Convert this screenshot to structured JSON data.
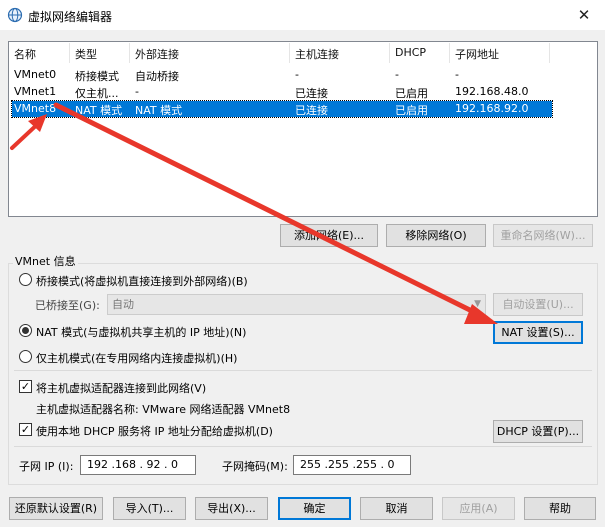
{
  "window": {
    "title": "虚拟网络编辑器",
    "close_glyph": "✕"
  },
  "table": {
    "headers": [
      "名称",
      "类型",
      "外部连接",
      "主机连接",
      "DHCP",
      "子网地址"
    ],
    "rows": [
      {
        "name": "VMnet0",
        "type": "桥接模式",
        "external": "自动桥接",
        "host": "-",
        "dhcp": "-",
        "subnet": "-",
        "selected": false
      },
      {
        "name": "VMnet1",
        "type": "仅主机...",
        "external": "-",
        "host": "已连接",
        "dhcp": "已启用",
        "subnet": "192.168.48.0",
        "selected": false
      },
      {
        "name": "VMnet8",
        "type": "NAT 模式",
        "external": "NAT 模式",
        "host": "已连接",
        "dhcp": "已启用",
        "subnet": "192.168.92.0",
        "selected": true
      }
    ]
  },
  "list_buttons": {
    "add": "添加网络(E)...",
    "remove": "移除网络(O)",
    "rename": "重命名网络(W)..."
  },
  "vmnet_info": {
    "group_title": "VMnet 信息",
    "bridge_mode": "桥接模式(将虚拟机直接连接到外部网络)(B)",
    "bridged_to_label": "已桥接至(G):",
    "bridged_to_value": "自动",
    "auto_settings": "自动设置(U)...",
    "nat_mode": "NAT 模式(与虚拟机共享主机的 IP 地址)(N)",
    "nat_settings": "NAT 设置(S)...",
    "host_only": "仅主机模式(在专用网络内连接虚拟机)(H)",
    "connect_adapter": "将主机虚拟适配器连接到此网络(V)",
    "adapter_name": "主机虚拟适配器名称: VMware 网络适配器 VMnet8",
    "use_dhcp": "使用本地 DHCP 服务将 IP 地址分配给虚拟机(D)",
    "dhcp_settings": "DHCP 设置(P)...",
    "subnet_ip_label": "子网 IP (I):",
    "subnet_ip": "192 .168 . 92 . 0",
    "subnet_mask_label": "子网掩码(M):",
    "subnet_mask": "255 .255 .255 . 0",
    "selected_mode": "nat",
    "connect_adapter_checked": true,
    "use_dhcp_checked": true
  },
  "footer": {
    "restore": "还原默认设置(R)",
    "import": "导入(T)...",
    "export": "导出(X)...",
    "ok": "确定",
    "cancel": "取消",
    "apply": "应用(A)",
    "help": "帮助"
  },
  "colors": {
    "selection": "#0078d7",
    "annotation_arrow": "#e8372b",
    "window_bg": "#f0f0f0"
  },
  "icons": {
    "title": "globe-network-icon",
    "dropdown": "chevron-down-icon",
    "checkbox": "checkmark-icon"
  }
}
